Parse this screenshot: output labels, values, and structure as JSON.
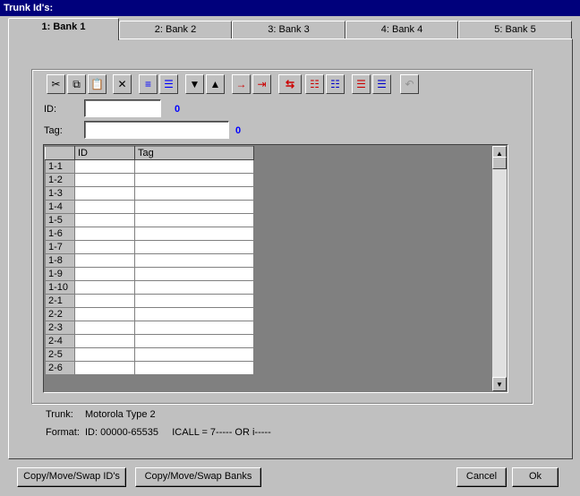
{
  "window": {
    "title": "Trunk Id's:"
  },
  "tabs": [
    "1: Bank 1",
    "2: Bank 2",
    "3: Bank 3",
    "4: Bank 4",
    "5: Bank 5"
  ],
  "toolbar": {
    "icons": [
      "scissors-icon",
      "copy-icon",
      "paste-icon",
      "delete-icon",
      "align-icon",
      "align-alt-icon",
      "move-down-icon",
      "move-up-icon",
      "insert-icon",
      "insert-below-icon",
      "swap-icon",
      "list-icon-1",
      "list-icon-2",
      "sort-asc-icon",
      "sort-desc-icon",
      "undo-icon"
    ]
  },
  "form": {
    "id_label": "ID:",
    "id_value": "",
    "id_count": "0",
    "tag_label": "Tag:",
    "tag_value": "",
    "tag_count": "0"
  },
  "grid": {
    "columns": [
      "ID",
      "Tag"
    ],
    "rows": [
      "1-1",
      "1-2",
      "1-3",
      "1-4",
      "1-5",
      "1-6",
      "1-7",
      "1-8",
      "1-9",
      "1-10",
      "2-1",
      "2-2",
      "2-3",
      "2-4",
      "2-5",
      "2-6"
    ]
  },
  "info": {
    "trunk_label": "Trunk:",
    "trunk_value": "Motorola Type 2",
    "format_label": "Format:",
    "format_value": "ID: 00000-65535     ICALL = 7----- OR i-----"
  },
  "buttons": {
    "copy_ids": "Copy/Move/Swap ID's",
    "copy_banks": "Copy/Move/Swap Banks",
    "cancel": "Cancel",
    "ok": "Ok"
  }
}
